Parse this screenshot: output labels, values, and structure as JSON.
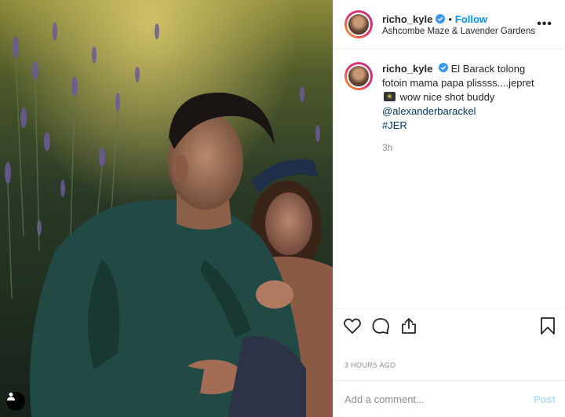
{
  "header": {
    "username": "richo_kyle",
    "separator": "•",
    "follow_label": "Follow",
    "location": "Ashcombe Maze & Lavender Gardens",
    "more_label": "•••"
  },
  "caption": {
    "username": "richo_kyle",
    "text_before": "El Barack tolong fotoin mama papa plissss....jepret",
    "text_after": "wow nice shot buddy",
    "mention": "@alexanderbarackel",
    "hashtag": "#JER",
    "time_ago": "3h"
  },
  "actions": {
    "like_icon": "heart-icon",
    "comment_icon": "comment-bubble-icon",
    "share_icon": "share-icon",
    "save_icon": "bookmark-icon"
  },
  "timestamp": "3 hours ago",
  "comment_box": {
    "placeholder": "Add a comment...",
    "post_label": "Post"
  },
  "colors": {
    "link": "#0095f6",
    "post_disabled": "#b2dffc",
    "meta": "#8e8e8e",
    "text": "#262626"
  }
}
